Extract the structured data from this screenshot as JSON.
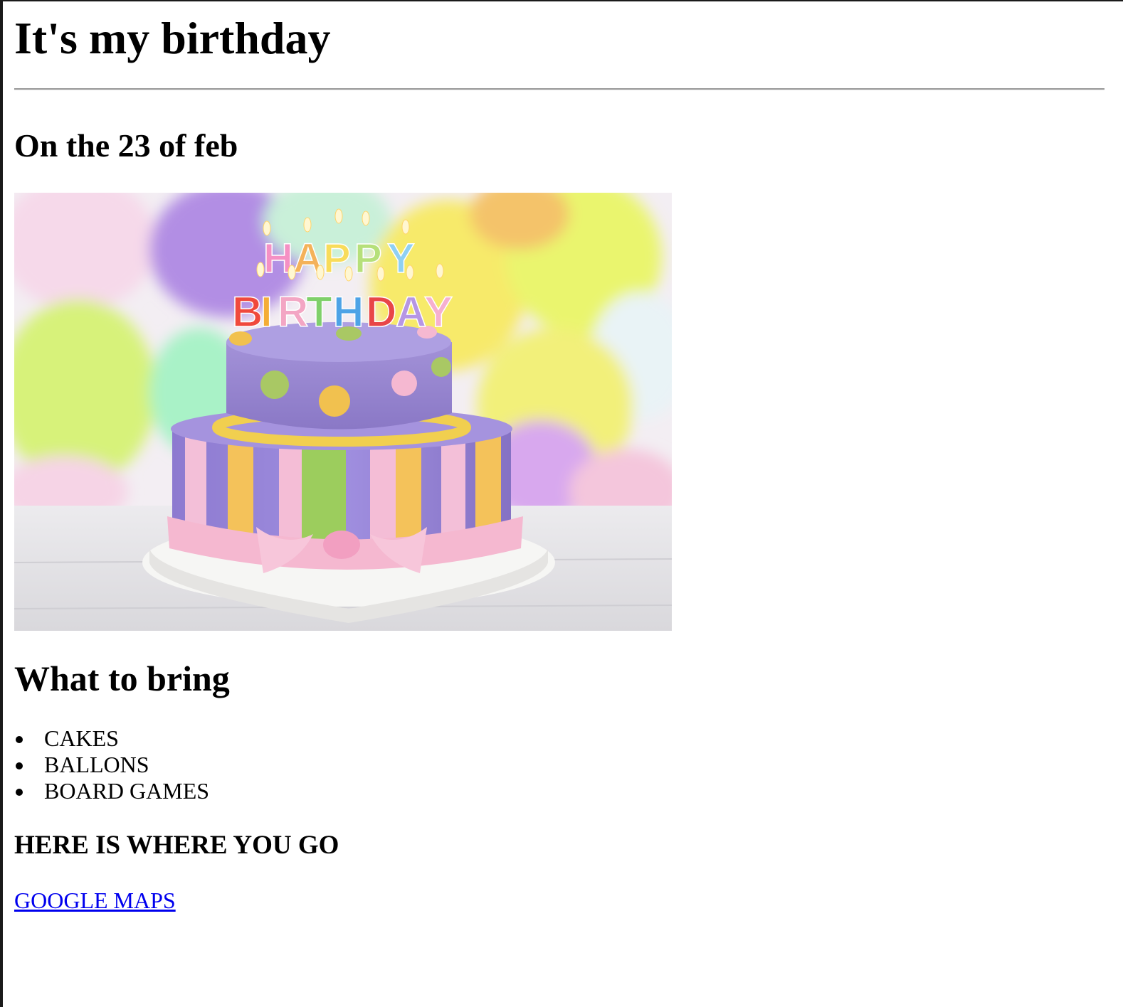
{
  "page": {
    "title": "It's my birthday",
    "date_heading": "On the 23 of feb",
    "image": {
      "semantic": "birthday-cake-image",
      "candle_text": [
        "HAPPY",
        "BIRTHDAY"
      ]
    },
    "bring": {
      "heading": "What to bring",
      "items": [
        "CAKES",
        "BALLONS",
        "BOARD GAMES"
      ]
    },
    "location": {
      "heading": "HERE IS WHERE YOU GO",
      "link_text": "GOOGLE MAPS"
    }
  },
  "colors": {
    "link": "#0000ee",
    "rule": "#9a9a9a"
  }
}
